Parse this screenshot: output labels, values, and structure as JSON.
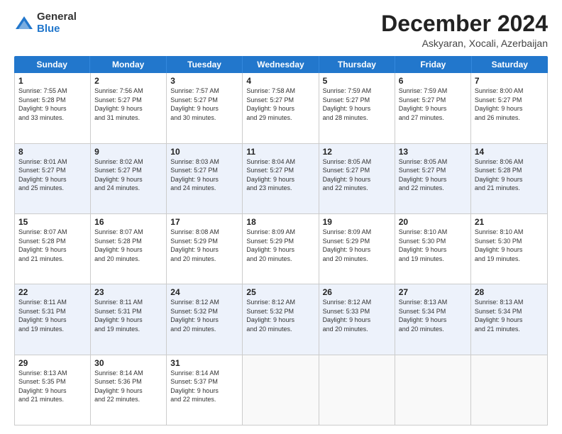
{
  "logo": {
    "general": "General",
    "blue": "Blue"
  },
  "title": "December 2024",
  "location": "Askyaran, Xocali, Azerbaijan",
  "header": {
    "days": [
      "Sunday",
      "Monday",
      "Tuesday",
      "Wednesday",
      "Thursday",
      "Friday",
      "Saturday"
    ]
  },
  "weeks": [
    {
      "alt": false,
      "cells": [
        {
          "day": "1",
          "lines": [
            "Sunrise: 7:55 AM",
            "Sunset: 5:28 PM",
            "Daylight: 9 hours",
            "and 33 minutes."
          ]
        },
        {
          "day": "2",
          "lines": [
            "Sunrise: 7:56 AM",
            "Sunset: 5:27 PM",
            "Daylight: 9 hours",
            "and 31 minutes."
          ]
        },
        {
          "day": "3",
          "lines": [
            "Sunrise: 7:57 AM",
            "Sunset: 5:27 PM",
            "Daylight: 9 hours",
            "and 30 minutes."
          ]
        },
        {
          "day": "4",
          "lines": [
            "Sunrise: 7:58 AM",
            "Sunset: 5:27 PM",
            "Daylight: 9 hours",
            "and 29 minutes."
          ]
        },
        {
          "day": "5",
          "lines": [
            "Sunrise: 7:59 AM",
            "Sunset: 5:27 PM",
            "Daylight: 9 hours",
            "and 28 minutes."
          ]
        },
        {
          "day": "6",
          "lines": [
            "Sunrise: 7:59 AM",
            "Sunset: 5:27 PM",
            "Daylight: 9 hours",
            "and 27 minutes."
          ]
        },
        {
          "day": "7",
          "lines": [
            "Sunrise: 8:00 AM",
            "Sunset: 5:27 PM",
            "Daylight: 9 hours",
            "and 26 minutes."
          ]
        }
      ]
    },
    {
      "alt": true,
      "cells": [
        {
          "day": "8",
          "lines": [
            "Sunrise: 8:01 AM",
            "Sunset: 5:27 PM",
            "Daylight: 9 hours",
            "and 25 minutes."
          ]
        },
        {
          "day": "9",
          "lines": [
            "Sunrise: 8:02 AM",
            "Sunset: 5:27 PM",
            "Daylight: 9 hours",
            "and 24 minutes."
          ]
        },
        {
          "day": "10",
          "lines": [
            "Sunrise: 8:03 AM",
            "Sunset: 5:27 PM",
            "Daylight: 9 hours",
            "and 24 minutes."
          ]
        },
        {
          "day": "11",
          "lines": [
            "Sunrise: 8:04 AM",
            "Sunset: 5:27 PM",
            "Daylight: 9 hours",
            "and 23 minutes."
          ]
        },
        {
          "day": "12",
          "lines": [
            "Sunrise: 8:05 AM",
            "Sunset: 5:27 PM",
            "Daylight: 9 hours",
            "and 22 minutes."
          ]
        },
        {
          "day": "13",
          "lines": [
            "Sunrise: 8:05 AM",
            "Sunset: 5:27 PM",
            "Daylight: 9 hours",
            "and 22 minutes."
          ]
        },
        {
          "day": "14",
          "lines": [
            "Sunrise: 8:06 AM",
            "Sunset: 5:28 PM",
            "Daylight: 9 hours",
            "and 21 minutes."
          ]
        }
      ]
    },
    {
      "alt": false,
      "cells": [
        {
          "day": "15",
          "lines": [
            "Sunrise: 8:07 AM",
            "Sunset: 5:28 PM",
            "Daylight: 9 hours",
            "and 21 minutes."
          ]
        },
        {
          "day": "16",
          "lines": [
            "Sunrise: 8:07 AM",
            "Sunset: 5:28 PM",
            "Daylight: 9 hours",
            "and 20 minutes."
          ]
        },
        {
          "day": "17",
          "lines": [
            "Sunrise: 8:08 AM",
            "Sunset: 5:29 PM",
            "Daylight: 9 hours",
            "and 20 minutes."
          ]
        },
        {
          "day": "18",
          "lines": [
            "Sunrise: 8:09 AM",
            "Sunset: 5:29 PM",
            "Daylight: 9 hours",
            "and 20 minutes."
          ]
        },
        {
          "day": "19",
          "lines": [
            "Sunrise: 8:09 AM",
            "Sunset: 5:29 PM",
            "Daylight: 9 hours",
            "and 20 minutes."
          ]
        },
        {
          "day": "20",
          "lines": [
            "Sunrise: 8:10 AM",
            "Sunset: 5:30 PM",
            "Daylight: 9 hours",
            "and 19 minutes."
          ]
        },
        {
          "day": "21",
          "lines": [
            "Sunrise: 8:10 AM",
            "Sunset: 5:30 PM",
            "Daylight: 9 hours",
            "and 19 minutes."
          ]
        }
      ]
    },
    {
      "alt": true,
      "cells": [
        {
          "day": "22",
          "lines": [
            "Sunrise: 8:11 AM",
            "Sunset: 5:31 PM",
            "Daylight: 9 hours",
            "and 19 minutes."
          ]
        },
        {
          "day": "23",
          "lines": [
            "Sunrise: 8:11 AM",
            "Sunset: 5:31 PM",
            "Daylight: 9 hours",
            "and 19 minutes."
          ]
        },
        {
          "day": "24",
          "lines": [
            "Sunrise: 8:12 AM",
            "Sunset: 5:32 PM",
            "Daylight: 9 hours",
            "and 20 minutes."
          ]
        },
        {
          "day": "25",
          "lines": [
            "Sunrise: 8:12 AM",
            "Sunset: 5:32 PM",
            "Daylight: 9 hours",
            "and 20 minutes."
          ]
        },
        {
          "day": "26",
          "lines": [
            "Sunrise: 8:12 AM",
            "Sunset: 5:33 PM",
            "Daylight: 9 hours",
            "and 20 minutes."
          ]
        },
        {
          "day": "27",
          "lines": [
            "Sunrise: 8:13 AM",
            "Sunset: 5:34 PM",
            "Daylight: 9 hours",
            "and 20 minutes."
          ]
        },
        {
          "day": "28",
          "lines": [
            "Sunrise: 8:13 AM",
            "Sunset: 5:34 PM",
            "Daylight: 9 hours",
            "and 21 minutes."
          ]
        }
      ]
    },
    {
      "alt": false,
      "cells": [
        {
          "day": "29",
          "lines": [
            "Sunrise: 8:13 AM",
            "Sunset: 5:35 PM",
            "Daylight: 9 hours",
            "and 21 minutes."
          ]
        },
        {
          "day": "30",
          "lines": [
            "Sunrise: 8:14 AM",
            "Sunset: 5:36 PM",
            "Daylight: 9 hours",
            "and 22 minutes."
          ]
        },
        {
          "day": "31",
          "lines": [
            "Sunrise: 8:14 AM",
            "Sunset: 5:37 PM",
            "Daylight: 9 hours",
            "and 22 minutes."
          ]
        },
        {
          "day": "",
          "lines": []
        },
        {
          "day": "",
          "lines": []
        },
        {
          "day": "",
          "lines": []
        },
        {
          "day": "",
          "lines": []
        }
      ]
    }
  ]
}
